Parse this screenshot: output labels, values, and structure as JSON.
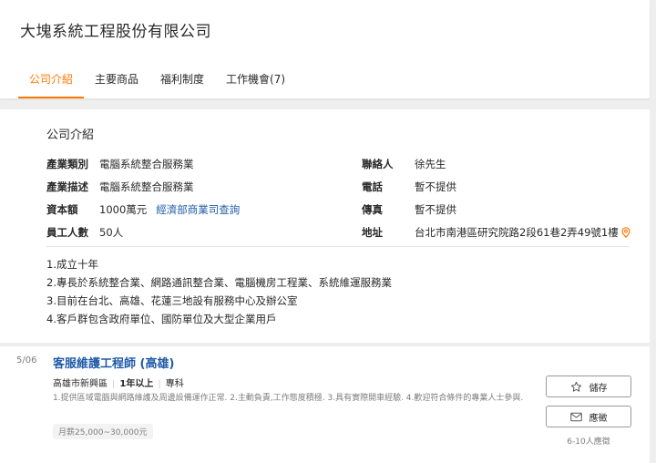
{
  "header": {
    "company_name": "大塊系統工程股份有限公司",
    "tabs": [
      {
        "label": "公司介紹"
      },
      {
        "label": "主要商品"
      },
      {
        "label": "福利制度"
      },
      {
        "label": "工作機會(7)"
      }
    ]
  },
  "intro": {
    "title": "公司介紹",
    "left": [
      {
        "key": "產業類別",
        "value": "電腦系統整合服務業"
      },
      {
        "key": "產業描述",
        "value": "電腦系統整合服務業"
      },
      {
        "key": "資本額",
        "value": "1000萬元",
        "link": "經濟部商業司查詢"
      },
      {
        "key": "員工人數",
        "value": "50人"
      }
    ],
    "right": [
      {
        "key": "聯絡人",
        "value": "徐先生"
      },
      {
        "key": "電話",
        "value": "暫不提供"
      },
      {
        "key": "傳真",
        "value": "暫不提供"
      },
      {
        "key": "地址",
        "value": "台北市南港區研究院路2段61巷2弄49號1樓"
      }
    ],
    "description": [
      "1.成立十年",
      "2.專長於系統整合業、網路通訊整合業、電腦機房工程業、系統維運服務業",
      "3.目前在台北、高雄、花蓮三地設有服務中心及辦公室",
      "4.客戶群包含政府單位、國防單位及大型企業用戶"
    ]
  },
  "job": {
    "date": "5/06",
    "title": "客服維護工程師 (高雄)",
    "location": "高雄市新興區",
    "experience": "1年以上",
    "education": "專科",
    "description": "1.提供區域電腦與網路維護及周邊設備運作正常. 2.主動負責,工作態度積極. 3.具有實際開車經驗. 4.歡迎符合條件的專業人士參與.",
    "salary": "月薪25,000~30,000元",
    "save_label": "儲存",
    "apply_label": "應徵",
    "apply_count": "6-10人應徵"
  },
  "colors": {
    "accent": "#ff7800",
    "link": "#1f5ba8"
  }
}
